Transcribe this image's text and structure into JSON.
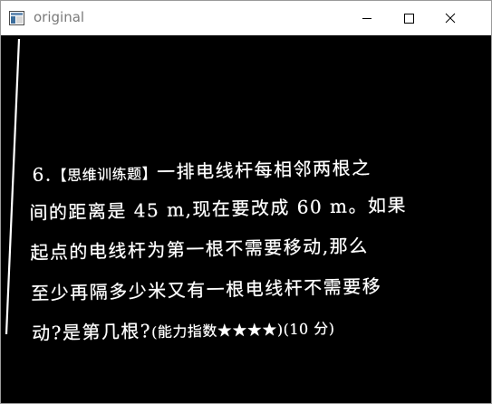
{
  "window": {
    "title": "original"
  },
  "problem": {
    "line1_number": "6.",
    "line1_tag": "【思维训练题】",
    "line1_text": "一排电线杆每相邻两根之",
    "line2": "间的距离是 45 m,现在要改成 60 m。如果",
    "line3": "起点的电线杆为第一根不需要移动,那么",
    "line4": "至少再隔多少米又有一根电线杆不需要移",
    "line5_text": "动?是第几根?",
    "line5_meta": "(能力指数★★★★)(10 分)"
  }
}
